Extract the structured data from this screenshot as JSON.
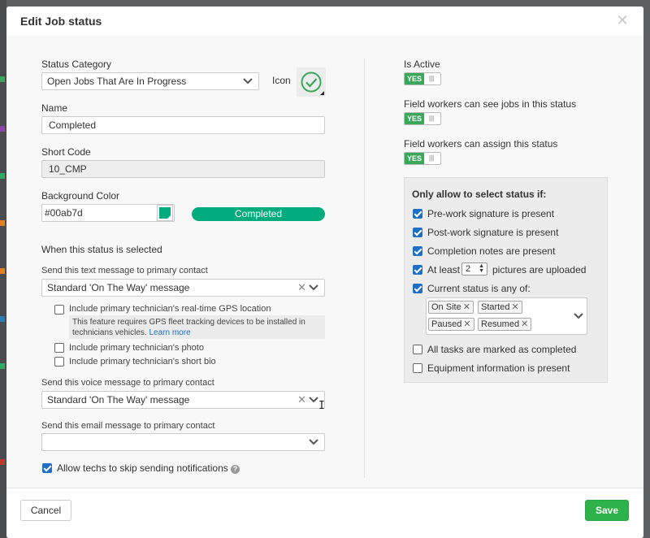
{
  "modal": {
    "title": "Edit Job status",
    "close_icon": "close-icon"
  },
  "left": {
    "status_category": {
      "label": "Status Category",
      "value": "Open Jobs That Are In Progress"
    },
    "icon": {
      "label": "Icon",
      "name": "checkmark-circle-icon",
      "color": "#3aa85a"
    },
    "name": {
      "label": "Name",
      "value": "Completed"
    },
    "short_code": {
      "label": "Short Code",
      "value": "10_CMP"
    },
    "background_color": {
      "label": "Background Color",
      "value": "#00ab7d",
      "preview_text": "Completed"
    },
    "when_selected": "When this status is selected",
    "text_message": {
      "label": "Send this text message to primary contact",
      "value": "Standard 'On The Way' message"
    },
    "gps_option": {
      "label": "Include primary technician's real-time GPS location",
      "checked": false
    },
    "gps_note": {
      "text": "This feature requires GPS fleet tracking devices to be installed in technicians vehicles.",
      "link": "Learn more"
    },
    "photo_option": {
      "label": "Include primary technician's photo",
      "checked": false
    },
    "bio_option": {
      "label": "Include primary technician's short bio",
      "checked": false
    },
    "voice_message": {
      "label": "Send this voice message to primary contact",
      "value": "Standard 'On The Way' message"
    },
    "email_message": {
      "label": "Send this email message to primary contact",
      "value": ""
    },
    "skip_notifications": {
      "label": "Allow techs to skip sending notifications",
      "checked": true
    }
  },
  "right": {
    "is_active": {
      "label": "Is Active",
      "toggle": "YES"
    },
    "workers_see": {
      "label": "Field workers can see jobs in this status",
      "toggle": "YES"
    },
    "workers_assign": {
      "label": "Field workers can assign this status",
      "toggle": "YES"
    },
    "conditions": {
      "title": "Only allow to select status if:",
      "pre_signature": {
        "label": "Pre-work signature is present",
        "checked": true
      },
      "post_signature": {
        "label": "Post-work signature is present",
        "checked": true
      },
      "completion_notes": {
        "label": "Completion notes are present",
        "checked": true
      },
      "pictures": {
        "prefix": "At least",
        "count": "2",
        "suffix": "pictures are uploaded",
        "checked": true
      },
      "current_status": {
        "label": "Current status is any of:",
        "checked": true,
        "tags": [
          "On Site",
          "Started",
          "Paused",
          "Resumed"
        ]
      },
      "tasks_completed": {
        "label": "All tasks are marked as completed",
        "checked": false
      },
      "equipment_info": {
        "label": "Equipment information is present",
        "checked": false
      }
    }
  },
  "footer": {
    "cancel_label": "Cancel",
    "save_label": "Save"
  },
  "colors": {
    "accent_green": "#2db34a",
    "checkbox_blue": "#1f6fc5",
    "preview_bg": "#00ab7d"
  }
}
